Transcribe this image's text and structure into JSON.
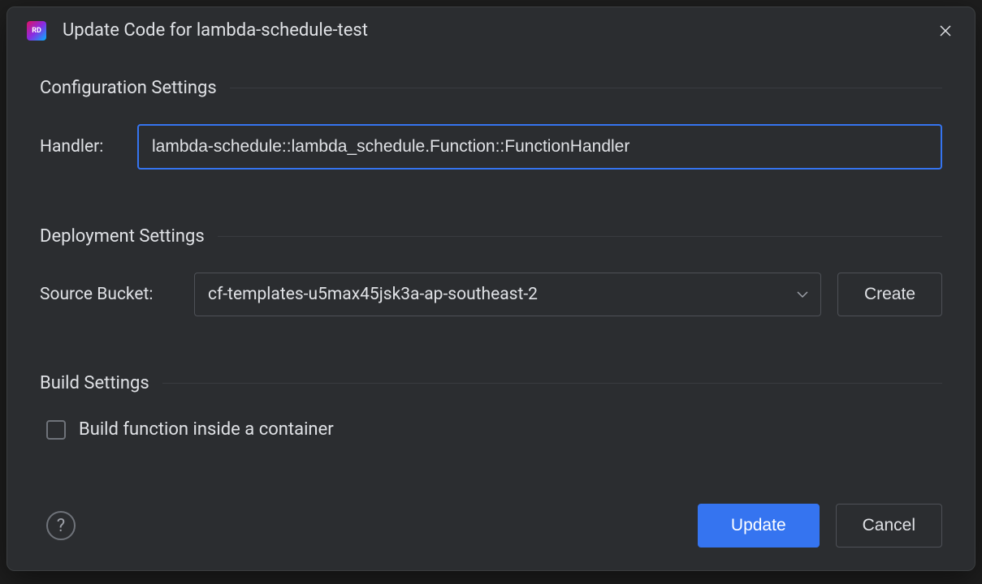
{
  "titlebar": {
    "app_icon_text": "RD",
    "title": "Update Code for lambda-schedule-test"
  },
  "sections": {
    "config": {
      "title": "Configuration Settings",
      "handler_label": "Handler:",
      "handler_value": "lambda-schedule::lambda_schedule.Function::FunctionHandler"
    },
    "deployment": {
      "title": "Deployment Settings",
      "source_bucket_label": "Source Bucket:",
      "source_bucket_value": "cf-templates-u5max45jsk3a-ap-southeast-2",
      "create_button": "Create"
    },
    "build": {
      "title": "Build Settings",
      "checkbox_label": "Build function inside a container",
      "checkbox_checked": false
    }
  },
  "footer": {
    "help_text": "?",
    "update_button": "Update",
    "cancel_button": "Cancel"
  }
}
